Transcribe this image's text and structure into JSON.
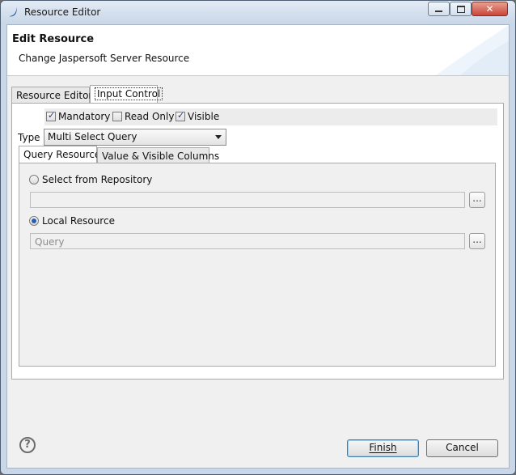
{
  "window": {
    "title": "Resource Editor"
  },
  "header": {
    "title": "Edit Resource",
    "description": "Change Jaspersoft Server Resource"
  },
  "tabs": [
    {
      "label": "Resource Editor",
      "selected": false
    },
    {
      "label": "Input Control",
      "selected": true
    }
  ],
  "flags": [
    {
      "label": "Mandatory",
      "checked": true
    },
    {
      "label": "Read Only",
      "checked": false
    },
    {
      "label": "Visible",
      "checked": true
    }
  ],
  "type": {
    "label": "Type",
    "value": "Multi Select Query"
  },
  "inner_tabs": [
    {
      "label": "Query Resource",
      "selected": true
    },
    {
      "label": "Value & Visible Columns",
      "selected": false
    }
  ],
  "source": {
    "repository": {
      "label": "Select from Repository",
      "selected": false,
      "value": "",
      "browse": "..."
    },
    "local": {
      "label": "Local Resource",
      "selected": true,
      "value": "Query",
      "browse": "..."
    }
  },
  "buttons": {
    "finish": "Finish",
    "cancel": "Cancel",
    "help": "?"
  },
  "colors": {
    "accent": "#3c7fb1",
    "window_frame": "#c9d7e8"
  },
  "icons": [
    "app-icon",
    "minimize-icon",
    "maximize-icon",
    "close-icon",
    "help-icon"
  ]
}
